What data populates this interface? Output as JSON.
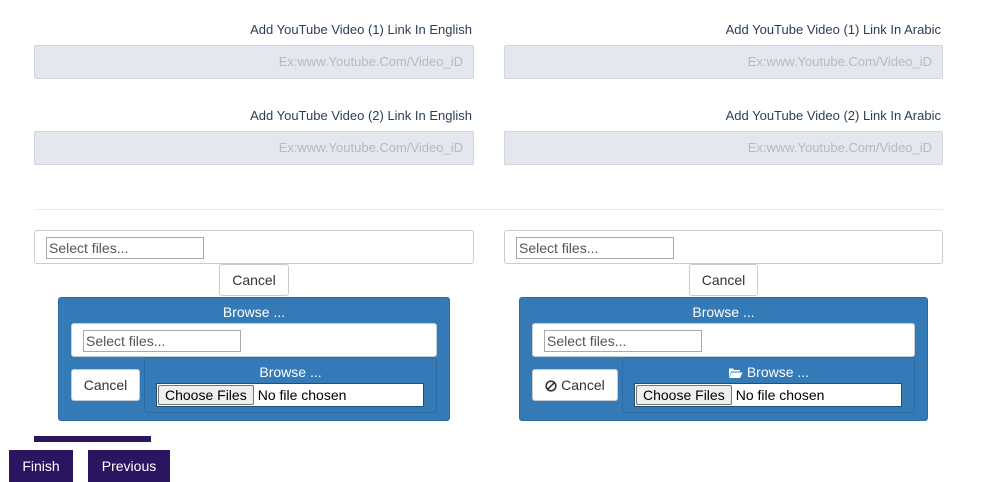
{
  "youtube": {
    "video1_en_label": "Add YouTube Video (1) Link In English",
    "video1_ar_label": "Add YouTube Video (1) Link In Arabic",
    "video2_en_label": "Add YouTube Video (2) Link In English",
    "video2_ar_label": "Add YouTube Video (2) Link In Arabic",
    "placeholder": "Ex:www.Youtube.Com/Video_iD"
  },
  "upload_left": {
    "select_placeholder": "Select files...",
    "cancel_label": "Cancel",
    "browse_title": "Browse ...",
    "inner_select_placeholder": "Select files...",
    "inner_cancel_label": "Cancel",
    "inner_browse_label": "Browse ...",
    "choose_files_label": "Choose Files",
    "no_file_label": "No file chosen"
  },
  "upload_right": {
    "select_placeholder": "Select files...",
    "cancel_label": "Cancel",
    "browse_title": "Browse ...",
    "inner_select_placeholder": "Select files...",
    "inner_cancel_label": "Cancel",
    "inner_browse_label": "Browse ...",
    "choose_files_label": "Choose Files",
    "no_file_label": "No file chosen",
    "cancel_icon": "ban-icon",
    "browse_icon": "folder-open-icon"
  },
  "footer": {
    "finish_label": "Finish",
    "previous_label": "Previous"
  },
  "colors": {
    "panel_blue": "#337ab7",
    "dark_button": "#2a1660",
    "input_gray": "#e4e7ee"
  }
}
